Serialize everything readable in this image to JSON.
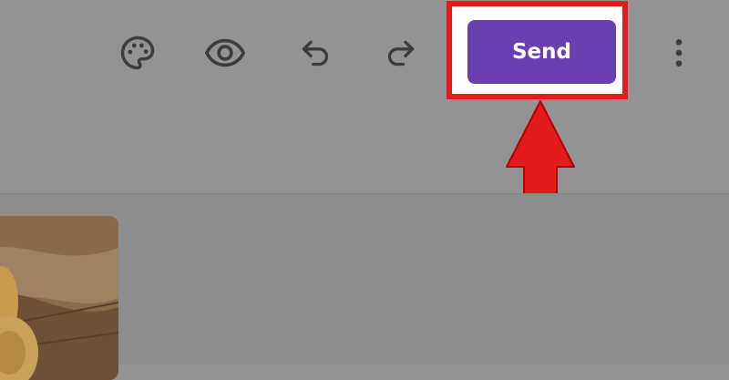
{
  "toolbar": {
    "send_label": "Send",
    "icons": [
      "palette-icon",
      "eye-icon",
      "undo-icon",
      "redo-icon",
      "more-vert-icon"
    ]
  },
  "colors": {
    "background": "#939393",
    "send_button": "#6a3fb2",
    "highlight": "#e41b1b",
    "arrow": "#e41b1b"
  },
  "annotation": {
    "highlight_target": "send-button",
    "arrow_direction": "up"
  }
}
